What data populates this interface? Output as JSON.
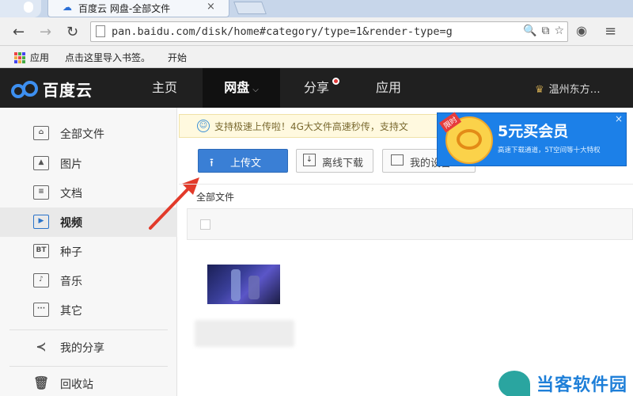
{
  "browser": {
    "tab_title": "百度云 网盘-全部文件",
    "tab_close": "×",
    "url": "pan.baidu.com/disk/home#category/type=1&render-type=g",
    "bookmarks": {
      "apps": "应用",
      "import": "点击这里导入书签。",
      "start": "开始"
    }
  },
  "header": {
    "logo_text": "百度云",
    "nav": {
      "home": "主页",
      "pan": "网盘",
      "share": "分享",
      "apps": "应用"
    },
    "user": "温州东方…"
  },
  "sidebar": {
    "items": [
      {
        "label": "全部文件",
        "icon": "all-files-icon"
      },
      {
        "label": "图片",
        "icon": "image-icon"
      },
      {
        "label": "文档",
        "icon": "document-icon"
      },
      {
        "label": "视频",
        "icon": "video-icon"
      },
      {
        "label": "种子",
        "icon": "bt-icon",
        "glyph": "BT"
      },
      {
        "label": "音乐",
        "icon": "music-icon"
      },
      {
        "label": "其它",
        "icon": "other-icon"
      },
      {
        "label": "我的分享",
        "icon": "share-icon"
      },
      {
        "label": "回收站",
        "icon": "trash-icon"
      }
    ],
    "active": "视频"
  },
  "notice": {
    "text": "支持极速上传啦！4G大文件高速秒传，支持文"
  },
  "vip_banner": {
    "ribbon": "限时",
    "title": "5元买会员",
    "subtitle": "高速下载通道，5T空间等十大特权",
    "close": "×"
  },
  "toolbar": {
    "upload": "上传文",
    "offline": "离线下载",
    "mine": "我的设备"
  },
  "breadcrumb": "全部文件",
  "watermark": "当客软件园",
  "colors": {
    "header_bg": "#202020",
    "accent": "#3a7fd5",
    "vip_bg": "#1c80e8",
    "arrow": "#e23a2a"
  }
}
